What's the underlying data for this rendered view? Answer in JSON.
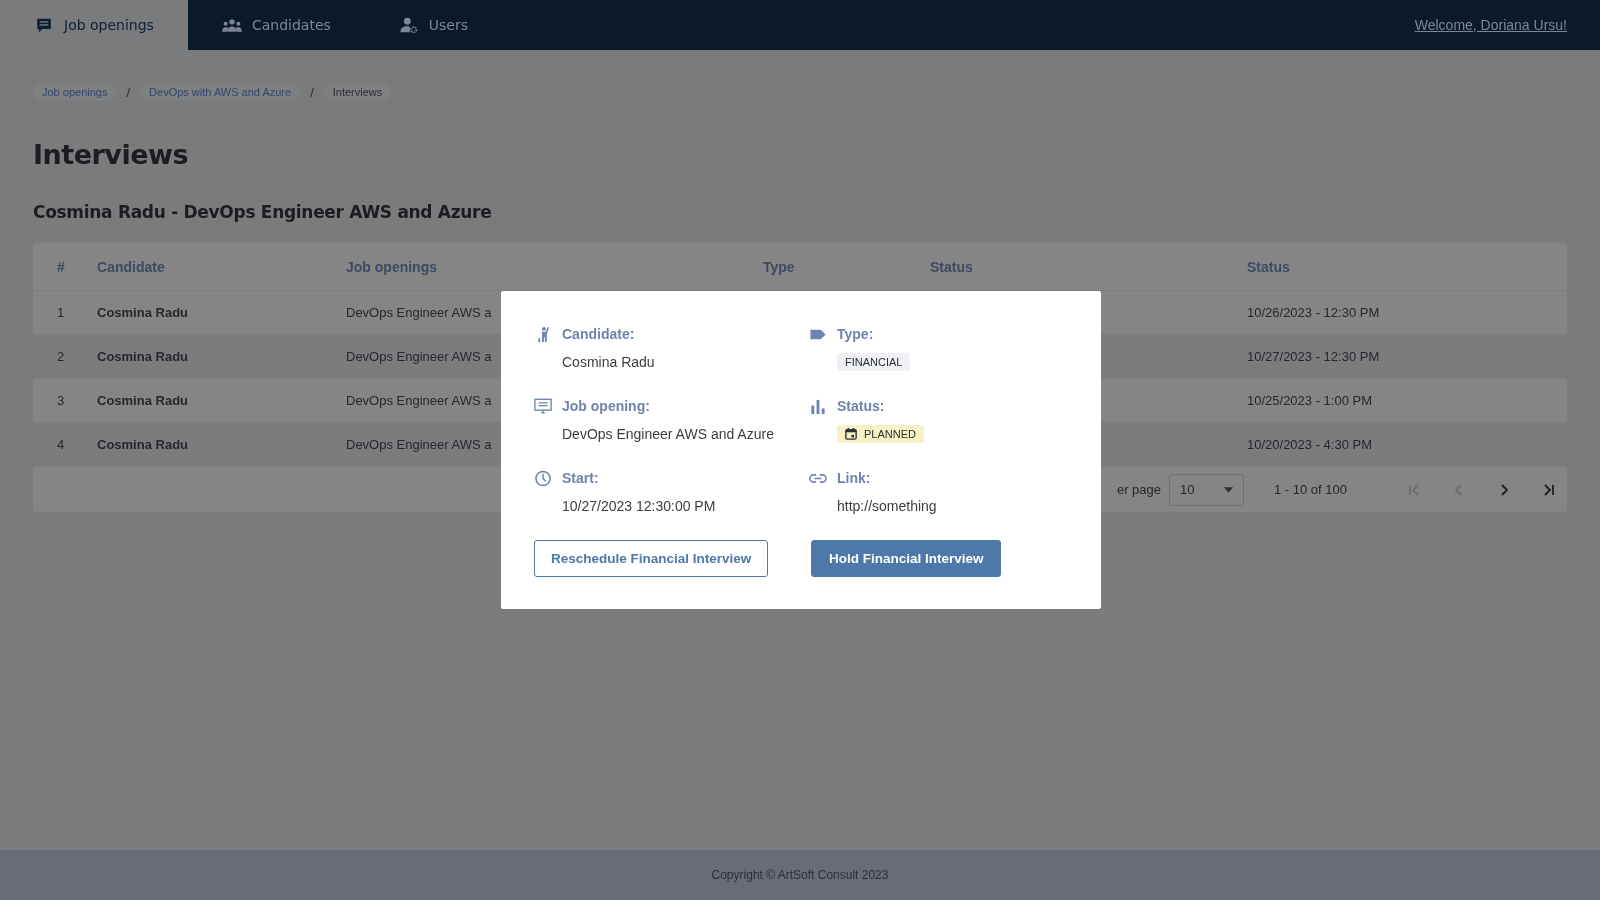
{
  "nav": {
    "tabs": [
      {
        "label": "Job openings",
        "selected": true
      },
      {
        "label": "Candidates",
        "selected": false
      },
      {
        "label": "Users",
        "selected": false
      }
    ],
    "welcome": "Welcome, Doriana Ursu!"
  },
  "breadcrumb": [
    {
      "label": "Job openings",
      "current": false
    },
    {
      "label": "DevOps with AWS and Azure",
      "current": false
    },
    {
      "label": "Interviews",
      "current": true
    }
  ],
  "breadcrumb_separators": [
    "/",
    "/"
  ],
  "title": "Interviews",
  "subtitle": "Cosmina Radu - DevOps Engineer AWS and Azure",
  "table": {
    "columns": [
      "#",
      "Candidate",
      "Job openings",
      "Type",
      "Status",
      "Status"
    ],
    "rows": [
      {
        "cells": [
          "1",
          "Cosmina Radu",
          "DevOps Engineer AWS a",
          "",
          "",
          "10/26/2023 - 12:30 PM"
        ]
      },
      {
        "cells": [
          "2",
          "Cosmina Radu",
          "DevOps Engineer AWS a",
          "",
          "",
          "10/27/2023 - 12:30 PM"
        ]
      },
      {
        "cells": [
          "3",
          "Cosmina Radu",
          "DevOps Engineer AWS a",
          "",
          "",
          "10/25/2023 - 1:00 PM"
        ]
      },
      {
        "cells": [
          "4",
          "Cosmina Radu",
          "DevOps Engineer AWS a",
          "",
          "",
          "10/20/2023 - 4:30 PM"
        ]
      }
    ],
    "pagination": {
      "per_page_label": "er page",
      "per_page": "10",
      "range": "1 - 10 of 100"
    }
  },
  "dialog": {
    "fields": [
      {
        "label": "Candidate:",
        "kind": "text",
        "value": "Cosmina Radu"
      },
      {
        "label": "Type:",
        "kind": "chip",
        "value": "FINANCIAL"
      },
      {
        "label": "Job opening:",
        "kind": "text",
        "value": "DevOps Engineer AWS and Azure"
      },
      {
        "label": "Status:",
        "kind": "status",
        "value": "PLANNED"
      },
      {
        "label": "Start:",
        "kind": "text",
        "value": "10/27/2023  12:30:00 PM"
      },
      {
        "label": "Link:",
        "kind": "text",
        "value": "http://something"
      }
    ],
    "buttons": [
      {
        "label": "Reschedule Financial Interview",
        "kind": "outline"
      },
      {
        "label": "Hold Financial Interview",
        "kind": "primary"
      }
    ]
  },
  "footer": "Copyright © ArtSoft Consult 2023"
}
